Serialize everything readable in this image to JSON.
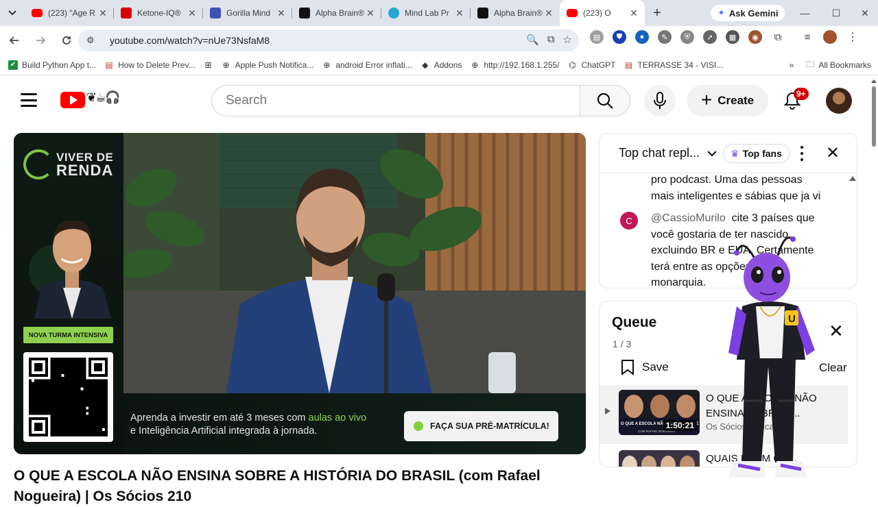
{
  "browser": {
    "tabs": [
      {
        "title": "(223) \"Age R",
        "favicon": "youtube-icon",
        "color": "#ff0000"
      },
      {
        "title": "Ketone-IQ®",
        "favicon": "ketone-icon",
        "color": "#d50000"
      },
      {
        "title": "Gorilla Mind",
        "favicon": "gorilla-mind-icon",
        "color": "#3f51b5"
      },
      {
        "title": "Alpha Brain®",
        "favicon": "onnit-icon",
        "color": "#111111"
      },
      {
        "title": "Mind Lab Pr",
        "favicon": "mind-lab-icon",
        "color": "#26a6d1"
      },
      {
        "title": "Alpha Brain®",
        "favicon": "onnit-icon",
        "color": "#111111"
      },
      {
        "title": "(223) O",
        "favicon": "youtube-icon",
        "color": "#ff0000",
        "active": true
      }
    ],
    "gemini_label": "Ask Gemini",
    "url": "youtube.com/watch?v=nUe73NsfaM8",
    "bookmarks": [
      {
        "label": "Build Python App t...",
        "icon": "check-icon"
      },
      {
        "label": "How to Delete Prev...",
        "icon": "page-icon"
      },
      {
        "label": "",
        "icon": "apps-grid-icon"
      },
      {
        "label": "Apple Push Notifica...",
        "icon": "globe-icon"
      },
      {
        "label": "android Error inflati...",
        "icon": "globe-icon"
      },
      {
        "label": "Addons",
        "icon": "diamond-icon"
      },
      {
        "label": "http://192.168.1.255/",
        "icon": "globe-icon"
      },
      {
        "label": "ChatGPT",
        "icon": "chatgpt-icon"
      },
      {
        "label": "TERRASSE 34 - VISI...",
        "icon": "page-icon"
      }
    ],
    "all_bookmarks_label": "All Bookmarks"
  },
  "youtube": {
    "search_placeholder": "Search",
    "create_label": "Create",
    "notification_badge": "9+",
    "accent": "#ff0000"
  },
  "player": {
    "ad": {
      "brand_line1": "VIVER DE",
      "brand_line2": "RENDA",
      "tag": "NOVA TURMA INTENSIVA",
      "banner_prefix": "Aprenda a investir em até 3 meses com ",
      "banner_highlight": "aulas ao vivo",
      "banner_line2": "e Inteligência Artificial integrada à jornada.",
      "cta": "FAÇA SUA PRÉ-MATRÍCULA!",
      "accent": "#8fd14f"
    }
  },
  "video": {
    "title": "O QUE A ESCOLA NÃO ENSINA SOBRE A HISTÓRIA DO BRASIL (com Rafael Nogueira) | Os Sócios 210"
  },
  "chat": {
    "mode_label": "Top chat repl...",
    "top_fans_label": "Top fans",
    "messages": [
      {
        "line1": "pro podcast. Uma das pessoas",
        "line2": "mais inteligentes e sábias que ja vi"
      },
      {
        "avatar_letter": "C",
        "author": "@CassioMurilo",
        "text1": "cite 3 países que",
        "text2": "você gostaria de ter nascido,",
        "text3": "excluindo BR e EUA. Certamente",
        "text4": "terá entre as opções uma",
        "text5": "monarquia."
      }
    ]
  },
  "queue": {
    "title": "Queue",
    "count": "1 / 3",
    "save_label": "Save",
    "clear_label": "Clear",
    "items": [
      {
        "title": "O QUE A ESCOLA NÃO ENSINA SOBRE A...",
        "channel": "Os Sócios Podcast",
        "duration": "1:50:21",
        "thumb_text": "O QUE A ESCOLA NÃO ENSINA SOBRE A HISTÓRIA DO BRASIL",
        "thumb_sub": "COM RAFAEL NOGUEIRA"
      },
      {
        "title": "QUAIS ERAM OS...",
        "channel": "",
        "duration": "",
        "thumb_text": "",
        "thumb_sub": ""
      }
    ]
  }
}
